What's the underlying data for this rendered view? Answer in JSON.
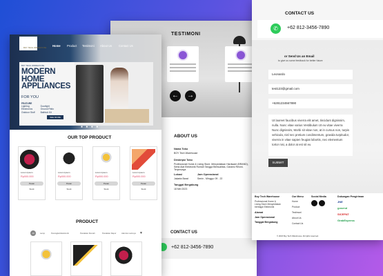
{
  "testimoni": {
    "title": "TESTIMONI",
    "prev_icon": "arrow-left-icon",
    "next_icon": "arrow-right-icon",
    "cards": [
      {
        "text": ""
      },
      {
        "text": ""
      },
      {
        "text": ""
      }
    ]
  },
  "about": {
    "title": "ABOUT US",
    "nama_label": "Nama Toko",
    "nama_value": "BOY Tech Warehouse",
    "deskripsi_label": "Deskripsi Toko",
    "deskripsi_value": "Professional Home & Living Store. Menyediakan Hardware (BRAND), Serta Alat Elektronik Rumah Tangga Berkualitas, Garansi Resmi, Terpercaya",
    "lokasi_label": "Lokasi",
    "lokasi_value": "Jakarta Barat",
    "jam_label": "Jam Operasional",
    "jam_value": "Senin - Minggu: 09 - 22",
    "tanggal_label": "Tanggal Bergabung",
    "tanggal_value": "18 Mei 2023"
  },
  "contact_bottom": {
    "title": "CONTACT US",
    "phone": "+62 812-3456-7890"
  },
  "contact": {
    "title": "CONTACT US",
    "phone": "+62 812-3456-7890",
    "or_label": "or Send Us an Email",
    "or_sub": "to give us some feedback for better future",
    "name_value": "Leonardo",
    "email_value": "test123@gmail.com",
    "phone_value": "+6281234567890",
    "message": "Ut laoreet faucibus viverra elit amet, tincidunt dignissim, nulla. Nunc vitae varius Vestibulum Ut eu vitae viverra Nunc dignissim, Morbi sit vitae non, at in cursus non, turpis vehicula, nisl nec pretium condimentum, gravida turpitudor, viverra in vitae sapien feugiat lobortis, nec elementum tortor nisi, a dolor at est sit eu",
    "submit_label": "SUBMIT"
  },
  "footer": {
    "brand": "Boy Tech Warehouse",
    "brand_desc": "Professional Home & Living Store Menyediakan berbagai Elektronik",
    "alamat_label": "Alamat",
    "jam_label": "Jam Operasional",
    "tanggal_label": "Tanggal Bergabung",
    "menu_title": "Our Menu",
    "menu": [
      "Home",
      "Product",
      "Testimoni",
      "About Us",
      "Contact Us"
    ],
    "social_title": "Social Media",
    "shipping_title": "Dukungan Pengiriman",
    "shipping": [
      "JNE",
      "gosend",
      "SICEPAT",
      "GrabExpress"
    ],
    "copyright": "© 2023 Boy Tech Warehouse. All rights reserved."
  },
  "home": {
    "logo_text": "BOY TECH WAREHOUSE",
    "nav": [
      "Home",
      "Product",
      "Testimoni",
      "About Us",
      "Contact Us"
    ],
    "hero_small": "BOY TECH WAREHOUSE",
    "hero_title_1": "MODERN",
    "hero_title_2": "HOME",
    "hero_title_3": "APPLIANCES",
    "hero_for": "FOR YOU",
    "hero_feature": "FEATURE",
    "hero_features": [
      "Lighting",
      "Electronics",
      "Outdoor Stuff",
      "Doorlight",
      "Ground Patio",
      "Bathtub Kit"
    ],
    "hero_cta": "SEE MORE",
    "top_product_title": "OUR TOP PRODUCT",
    "top_products": [
      {
        "name": "Lorem Ipsum",
        "price": "Rp000.000",
        "btn": "Pesan",
        "sub": "Stock"
      },
      {
        "name": "Lorem Ipsum",
        "price": "Rp000.000",
        "btn": "Pesan",
        "sub": "Stock"
      },
      {
        "name": "Lorem Ipsum",
        "price": "Rp000.000",
        "btn": "Pesan",
        "sub": "Stock"
      },
      {
        "name": "Lorem Ipsum",
        "price": "Rp000.000",
        "btn": "Pesan",
        "sub": "Stock"
      }
    ],
    "product_title": "PRODUCT",
    "filters": [
      "All",
      "Lamp",
      "Perangkat Elektronik",
      "Peralatan Rumah",
      "Peralatan Dapur",
      "Alat dan Lainnya"
    ]
  },
  "colors": {
    "accent_navy": "#1c3557",
    "price_pink": "#e24b6a",
    "whatsapp_green": "#2ecc5b",
    "avatar_purple": "#8a56d6"
  }
}
